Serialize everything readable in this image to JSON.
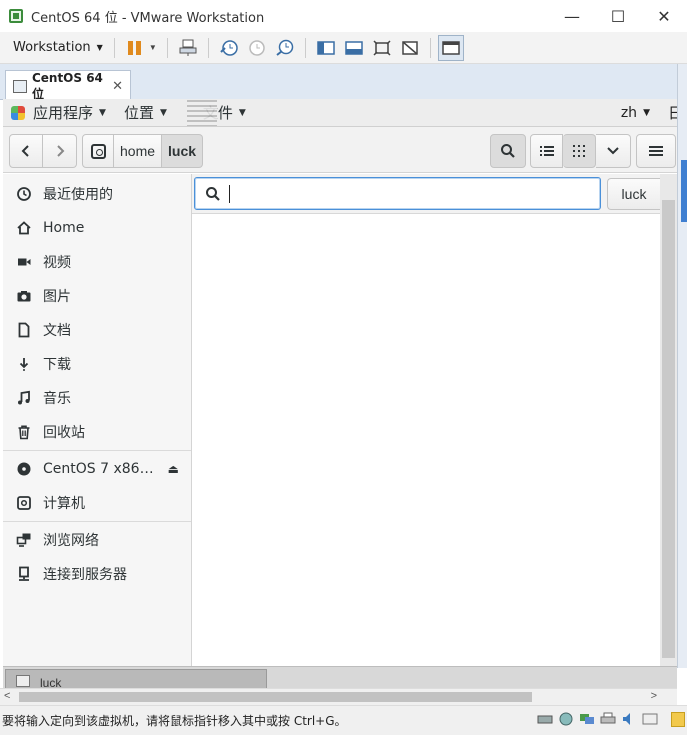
{
  "vmware": {
    "title": "CentOS 64 位 - VMware Workstation",
    "window_buttons": {
      "minimize": "—",
      "maximize": "☐",
      "close": "✕"
    },
    "toolbar": {
      "workstation_menu": "Workstation"
    },
    "tab": {
      "label": "CentOS 64 位",
      "close": "✕"
    },
    "status_text": "要将输入定向到该虚拟机，请将鼠标指针移入其中或按 Ctrl+G。",
    "status_icons": [
      "hdd-icon",
      "network-icon",
      "display-icon",
      "printer-icon",
      "sound-icon",
      "usb-icon"
    ]
  },
  "guest_topbar": {
    "applications": "应用程序",
    "places": "位置",
    "files": "文件",
    "language": "zh",
    "date_partial": "日"
  },
  "nautilus": {
    "breadcrumbs": [
      "home",
      "luck"
    ],
    "search": {
      "value": "",
      "placeholder": ""
    },
    "location_button": "luck",
    "sidebar": {
      "items": [
        {
          "label": "最近使用的",
          "icon": "recent-icon"
        },
        {
          "label": "Home",
          "icon": "home-icon"
        },
        {
          "label": "视频",
          "icon": "video-icon"
        },
        {
          "label": "图片",
          "icon": "camera-icon"
        },
        {
          "label": "文档",
          "icon": "document-icon"
        },
        {
          "label": "下载",
          "icon": "download-icon"
        },
        {
          "label": "音乐",
          "icon": "music-icon"
        },
        {
          "label": "回收站",
          "icon": "trash-icon"
        }
      ],
      "devices": [
        {
          "label": "CentOS 7 x86…",
          "icon": "disc-icon"
        },
        {
          "label": "计算机",
          "icon": "computer-icon"
        }
      ],
      "network": [
        {
          "label": "浏览网络",
          "icon": "network-browse-icon"
        },
        {
          "label": "连接到服务器",
          "icon": "server-connect-icon"
        }
      ]
    }
  },
  "guest_taskbar": {
    "window_button": "luck"
  }
}
